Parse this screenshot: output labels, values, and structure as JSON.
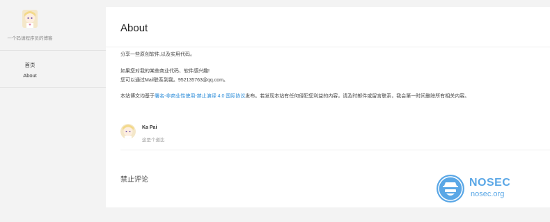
{
  "sidebar": {
    "description": "一个码请程序员的博客",
    "nav": [
      {
        "label": "首页"
      },
      {
        "label": "About"
      }
    ]
  },
  "page": {
    "title": "About",
    "intro": "分享一些原创软件,以及实用代码。",
    "interest_line1": "如果您对我的某些商业代码、软件感兴趣!",
    "interest_line2": "您可以通过Mail联系到我。952135763@qq.com。",
    "license_prefix": "本站博文均基于",
    "license_link": "署名-非商业性使用-禁止演绎 4.0 国际协议",
    "license_suffix": "发布。若发现本站有任何侵犯您利益的内容，请及时邮件或留言联系，我会第一时间删除所有相关内容。"
  },
  "author": {
    "name": "Ka Pai",
    "bio": "这是个道比"
  },
  "comments": {
    "status": "禁止评论"
  },
  "watermark": {
    "name": "NOSEC",
    "url": "nosec.org",
    "color": "#5aa7e6"
  }
}
